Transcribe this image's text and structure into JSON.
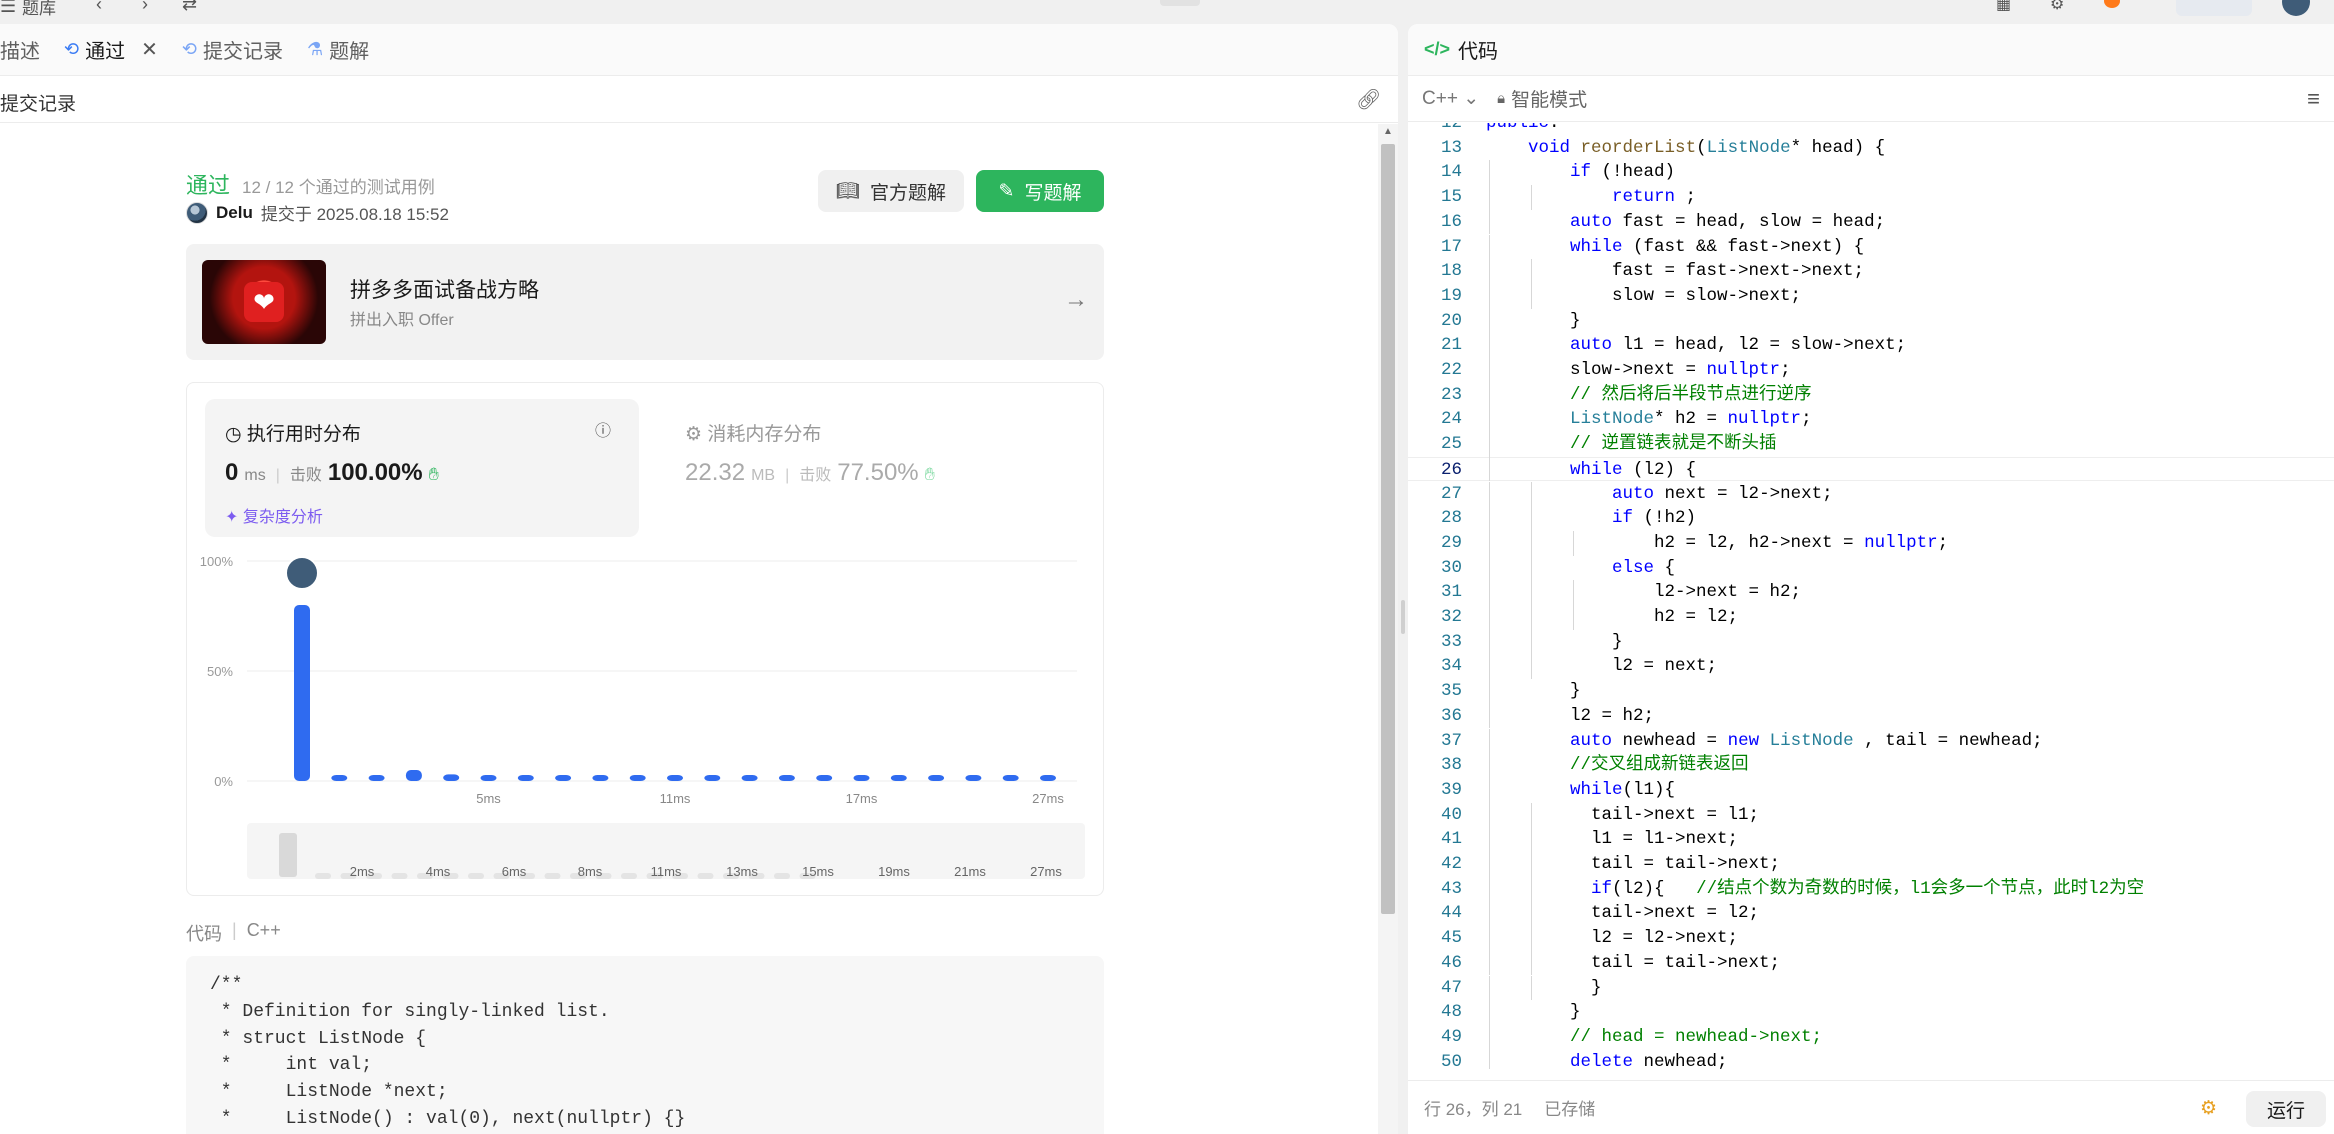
{
  "topbar": {
    "app_label": "题库"
  },
  "left_tabs": [
    {
      "label": "描述",
      "icon": "doc-icon"
    },
    {
      "label": "通过",
      "icon": "history-icon"
    },
    {
      "label": "提交记录",
      "icon": "history-icon"
    },
    {
      "label": "题解",
      "icon": "flask-icon"
    }
  ],
  "submission": {
    "header": "提交记录",
    "status": "通过",
    "cases": "12 / 12 个通过的测试用例",
    "author": "Delu",
    "submitted_at": "提交于 2025.08.18 15:52",
    "official_button": "官方题解",
    "write_button": "写题解"
  },
  "promo": {
    "title": "拼多多面试备战方略",
    "subtitle": "拼出入职 Offer"
  },
  "runtime": {
    "title": "执行用时分布",
    "value": "0",
    "unit": "ms",
    "beat_label": "击败",
    "beat_pct": "100.00%",
    "complexity": "复杂度分析"
  },
  "memory": {
    "title": "消耗内存分布",
    "value": "22.32",
    "unit": "MB",
    "beat_label": "击败",
    "beat_pct": "77.50%"
  },
  "chart_data": {
    "type": "bar",
    "title": "",
    "y_ticks": [
      "100%",
      "50%",
      "0%"
    ],
    "ylim": [
      0,
      100
    ],
    "x_tick_labels": [
      "5ms",
      "11ms",
      "17ms",
      "27ms"
    ],
    "values": [
      80,
      2,
      2,
      5,
      3,
      2,
      2,
      2,
      2,
      2,
      2,
      2,
      2,
      2,
      2,
      2,
      2,
      2,
      2,
      2,
      2
    ],
    "highlight_index": 0,
    "overview_labels": [
      "2ms",
      "4ms",
      "6ms",
      "8ms",
      "11ms",
      "13ms",
      "15ms",
      "19ms",
      "21ms",
      "27ms"
    ],
    "colors": {
      "bar": "#2f6bf0",
      "overview": "#d9d9d9",
      "grid": "#ececec"
    }
  },
  "code_section": {
    "label": "代码",
    "lang": "C++",
    "preview": "/**\n * Definition for singly-linked list.\n * struct ListNode {\n *     int val;\n *     ListNode *next;\n *     ListNode() : val(0), next(nullptr) {}\n *     ListNode(int x) : val(x), next(nullptr) {}"
  },
  "editor": {
    "tab_label": "代码",
    "lang": "C++",
    "mode": "智能模式",
    "status_pos": "行 26，列 21",
    "status_saved": "已存储",
    "run_button": "运行",
    "current_line": 26,
    "lines": [
      [
        "12",
        "public:"
      ],
      [
        "13",
        "    void reorderList(ListNode* head) {"
      ],
      [
        "14",
        "        if (!head)"
      ],
      [
        "15",
        "            return ;"
      ],
      [
        "16",
        "        auto fast = head, slow = head;"
      ],
      [
        "17",
        "        while (fast && fast->next) {"
      ],
      [
        "18",
        "            fast = fast->next->next;"
      ],
      [
        "19",
        "            slow = slow->next;"
      ],
      [
        "20",
        "        }"
      ],
      [
        "21",
        "        auto l1 = head, l2 = slow->next;"
      ],
      [
        "22",
        "        slow->next = nullptr;"
      ],
      [
        "23",
        "        // 然后将后半段节点进行逆序"
      ],
      [
        "24",
        "        ListNode* h2 = nullptr;"
      ],
      [
        "25",
        "        // 逆置链表就是不断头插"
      ],
      [
        "26",
        "        while (l2) {"
      ],
      [
        "27",
        "            auto next = l2->next;"
      ],
      [
        "28",
        "            if (!h2)"
      ],
      [
        "29",
        "                h2 = l2, h2->next = nullptr;"
      ],
      [
        "30",
        "            else {"
      ],
      [
        "31",
        "                l2->next = h2;"
      ],
      [
        "32",
        "                h2 = l2;"
      ],
      [
        "33",
        "            }"
      ],
      [
        "34",
        "            l2 = next;"
      ],
      [
        "35",
        "        }"
      ],
      [
        "36",
        "        l2 = h2;"
      ],
      [
        "37",
        "        auto newhead = new ListNode , tail = newhead;"
      ],
      [
        "38",
        "        //交叉组成新链表返回"
      ],
      [
        "39",
        "        while(l1){"
      ],
      [
        "40",
        "          tail->next = l1;"
      ],
      [
        "41",
        "          l1 = l1->next;"
      ],
      [
        "42",
        "          tail = tail->next;"
      ],
      [
        "43",
        "          if(l2){   //结点个数为奇数的时候，l1会多一个节点，此时l2为空"
      ],
      [
        "44",
        "          tail->next = l2;"
      ],
      [
        "45",
        "          l2 = l2->next;"
      ],
      [
        "46",
        "          tail = tail->next;"
      ],
      [
        "47",
        "          }"
      ],
      [
        "48",
        "        }"
      ],
      [
        "49",
        "        // head = newhead->next;"
      ],
      [
        "50",
        "        delete newhead;"
      ]
    ]
  }
}
